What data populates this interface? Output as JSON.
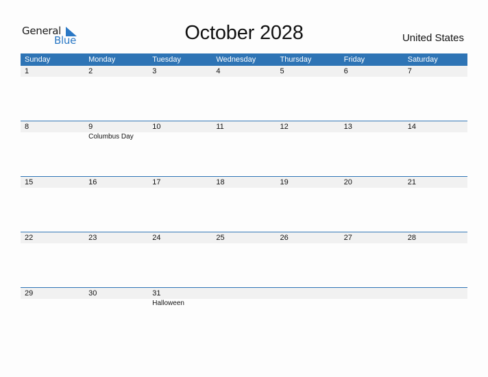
{
  "logo": {
    "word1": "General",
    "word2": "Blue",
    "accent": "#2a78c5"
  },
  "title": "October 2028",
  "country": "United States",
  "colors": {
    "header_bg": "#2e74b5",
    "date_band": "#f1f1f1"
  },
  "weekdays": [
    "Sunday",
    "Monday",
    "Tuesday",
    "Wednesday",
    "Thursday",
    "Friday",
    "Saturday"
  ],
  "weeks": [
    {
      "days": [
        {
          "n": "1",
          "ev": ""
        },
        {
          "n": "2",
          "ev": ""
        },
        {
          "n": "3",
          "ev": ""
        },
        {
          "n": "4",
          "ev": ""
        },
        {
          "n": "5",
          "ev": ""
        },
        {
          "n": "6",
          "ev": ""
        },
        {
          "n": "7",
          "ev": ""
        }
      ]
    },
    {
      "days": [
        {
          "n": "8",
          "ev": ""
        },
        {
          "n": "9",
          "ev": "Columbus Day"
        },
        {
          "n": "10",
          "ev": ""
        },
        {
          "n": "11",
          "ev": ""
        },
        {
          "n": "12",
          "ev": ""
        },
        {
          "n": "13",
          "ev": ""
        },
        {
          "n": "14",
          "ev": ""
        }
      ]
    },
    {
      "days": [
        {
          "n": "15",
          "ev": ""
        },
        {
          "n": "16",
          "ev": ""
        },
        {
          "n": "17",
          "ev": ""
        },
        {
          "n": "18",
          "ev": ""
        },
        {
          "n": "19",
          "ev": ""
        },
        {
          "n": "20",
          "ev": ""
        },
        {
          "n": "21",
          "ev": ""
        }
      ]
    },
    {
      "days": [
        {
          "n": "22",
          "ev": ""
        },
        {
          "n": "23",
          "ev": ""
        },
        {
          "n": "24",
          "ev": ""
        },
        {
          "n": "25",
          "ev": ""
        },
        {
          "n": "26",
          "ev": ""
        },
        {
          "n": "27",
          "ev": ""
        },
        {
          "n": "28",
          "ev": ""
        }
      ]
    },
    {
      "days": [
        {
          "n": "29",
          "ev": ""
        },
        {
          "n": "30",
          "ev": ""
        },
        {
          "n": "31",
          "ev": "Halloween"
        },
        {
          "n": "",
          "ev": ""
        },
        {
          "n": "",
          "ev": ""
        },
        {
          "n": "",
          "ev": ""
        },
        {
          "n": "",
          "ev": ""
        }
      ]
    }
  ]
}
